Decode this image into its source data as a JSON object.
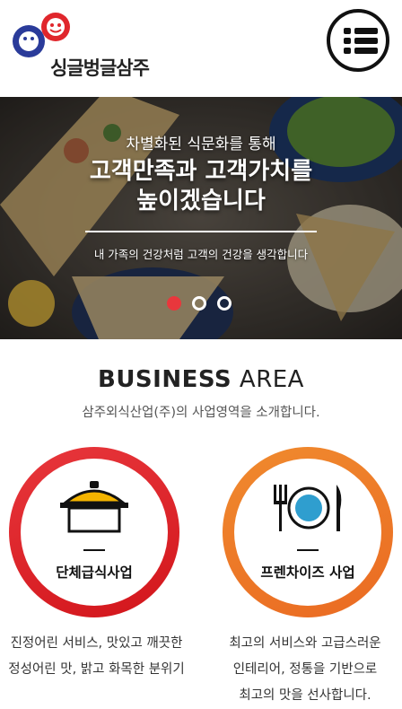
{
  "header": {
    "logo_text": "싱글벙글삼주",
    "menu_label": ""
  },
  "hero": {
    "subtitle": "차별화된 식문화를 통해",
    "title_line1": "고객만족과 고객가치를",
    "title_line2": "높이겠습니다",
    "caption": "내 가족의 건강처럼 고객의 건강을 생각합니다",
    "slides": [
      {
        "active": true
      },
      {
        "active": false
      },
      {
        "active": false
      }
    ]
  },
  "business": {
    "title_bold": "BUSINESS",
    "title_light": "AREA",
    "subtitle": "삼주외식산업(주)의 사업영역을 소개합니다.",
    "items": [
      {
        "label": "단체급식사업",
        "icon": "pot-icon",
        "desc_line1": "진정어린 서비스, 맛있고 깨끗한",
        "desc_line2": "정성어린 맛, 밝고 화목한 분위기",
        "desc_line3": ""
      },
      {
        "label": "프렌차이즈 사업",
        "icon": "plate-fork-knife-icon",
        "desc_line1": "최고의 서비스와 고급스러운",
        "desc_line2": "인테리어, 정통을 기반으로",
        "desc_line3": "최고의 맛을 선사합니다."
      }
    ]
  },
  "colors": {
    "red_accent": "#e0262c",
    "orange_accent": "#f07a2a",
    "pot_lid": "#f4b400",
    "dot_active": "#e8373c"
  }
}
